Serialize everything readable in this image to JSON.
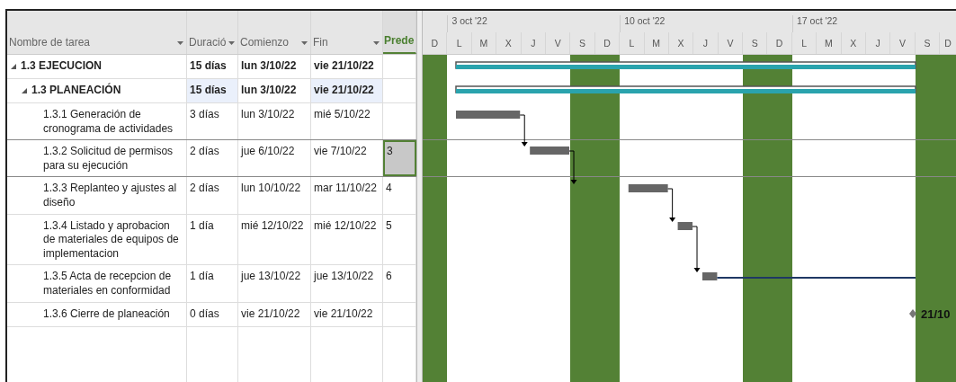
{
  "columns": [
    {
      "label": "Nombre de tarea",
      "dropdown": true,
      "active": false
    },
    {
      "label": "Duració",
      "dropdown": true,
      "active": false
    },
    {
      "label": "Comienzo",
      "dropdown": true,
      "active": false
    },
    {
      "label": "Fin",
      "dropdown": true,
      "active": false
    },
    {
      "label": "Prede",
      "dropdown": false,
      "active": true
    }
  ],
  "timescale": {
    "weeks": [
      {
        "label": "3 oct '22"
      },
      {
        "label": "10 oct '22"
      },
      {
        "label": "17 oct '22"
      }
    ],
    "days": [
      {
        "label": "D",
        "weekend": true
      },
      {
        "label": "L",
        "weekend": false
      },
      {
        "label": "M",
        "weekend": false
      },
      {
        "label": "X",
        "weekend": false
      },
      {
        "label": "J",
        "weekend": false
      },
      {
        "label": "V",
        "weekend": false
      },
      {
        "label": "S",
        "weekend": true
      },
      {
        "label": "D",
        "weekend": true
      },
      {
        "label": "L",
        "weekend": false
      },
      {
        "label": "M",
        "weekend": false
      },
      {
        "label": "X",
        "weekend": false
      },
      {
        "label": "J",
        "weekend": false
      },
      {
        "label": "V",
        "weekend": false
      },
      {
        "label": "S",
        "weekend": true
      },
      {
        "label": "D",
        "weekend": true
      },
      {
        "label": "L",
        "weekend": false
      },
      {
        "label": "M",
        "weekend": false
      },
      {
        "label": "X",
        "weekend": false
      },
      {
        "label": "J",
        "weekend": false
      },
      {
        "label": "V",
        "weekend": false
      },
      {
        "label": "S",
        "weekend": true
      },
      {
        "label": "D",
        "weekend": true
      }
    ]
  },
  "tasks": [
    {
      "name": "1.3 EJECUCION",
      "duration": "15 días",
      "start": "lun 3/10/22",
      "finish": "vie 21/10/22",
      "kind": "summary",
      "expanded": true,
      "selected": false,
      "highlight": false,
      "children": [
        {
          "name": "1.3  PLANEACIÓN",
          "duration": "15 días",
          "start": "lun 3/10/22",
          "finish": "vie 21/10/22",
          "kind": "summary",
          "expanded": true,
          "selected": false,
          "highlight": true,
          "children": [
            {
              "name": "1.3.1 Generación de cronograma de actividades",
              "duration": "3 días",
              "start": "lun 3/10/22",
              "finish": "mié 5/10/22",
              "kind": "task",
              "selected": false,
              "highlight": false,
              "linked": false
            },
            {
              "name": "1.3.2 Solicitud de permisos para su ejecución",
              "duration": "2 días",
              "start": "jue 6/10/22",
              "finish": "vie 7/10/22",
              "predecessor": "3",
              "kind": "task",
              "selected": true,
              "highlight": false,
              "linked": true
            },
            {
              "name": "1.3.3 Replanteo y ajustes al diseño",
              "duration": "2 días",
              "start": "lun 10/10/22",
              "finish": "mar 11/10/22",
              "predecessor": "4",
              "kind": "task",
              "selected": false,
              "highlight": false,
              "linked": true
            },
            {
              "name": "1.3.4 Listado y aprobacion de materiales de equipos de implementacion",
              "duration": "1 día",
              "start": "mié 12/10/22",
              "finish": "mié 12/10/22",
              "predecessor": "5",
              "kind": "task",
              "selected": false,
              "highlight": false,
              "linked": true
            },
            {
              "name": "1.3.5 Acta de recepcion de materiales en conformidad",
              "duration": "1 día",
              "start": "jue 13/10/22",
              "finish": "jue 13/10/22",
              "predecessor": "6",
              "kind": "task",
              "selected": false,
              "highlight": false,
              "linked": true
            },
            {
              "name": "1.3.6 Cierre de planeación",
              "duration": "0 días",
              "start": "vie 21/10/22",
              "finish": "vie 21/10/22",
              "kind": "milestone",
              "selected": false,
              "highlight": false,
              "linked": true,
              "milestone_label": "21/10"
            }
          ]
        }
      ]
    }
  ]
}
